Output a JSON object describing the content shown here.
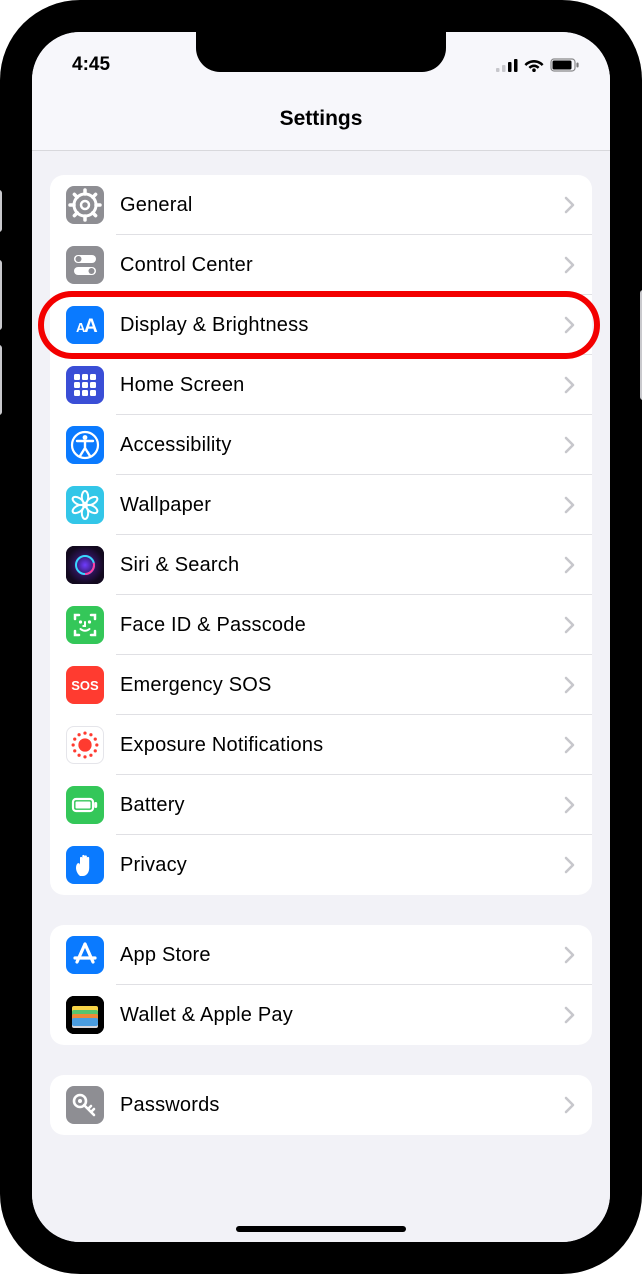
{
  "status": {
    "time": "4:45"
  },
  "header": {
    "title": "Settings"
  },
  "groups": [
    {
      "items": [
        {
          "id": "general",
          "label": "General",
          "icon": "gear",
          "iconBg": "#8e8e93",
          "highlighted": false
        },
        {
          "id": "control-center",
          "label": "Control Center",
          "icon": "toggles",
          "iconBg": "#8e8e93",
          "highlighted": false
        },
        {
          "id": "display-brightness",
          "label": "Display & Brightness",
          "icon": "textsize",
          "iconBg": "#0a7aff",
          "highlighted": true
        },
        {
          "id": "home-screen",
          "label": "Home Screen",
          "icon": "grid",
          "iconBg": "#3a4ed6",
          "highlighted": false
        },
        {
          "id": "accessibility",
          "label": "Accessibility",
          "icon": "accessibility",
          "iconBg": "#0a7aff",
          "highlighted": false
        },
        {
          "id": "wallpaper",
          "label": "Wallpaper",
          "icon": "flower",
          "iconBg": "#33c6e8",
          "highlighted": false
        },
        {
          "id": "siri-search",
          "label": "Siri & Search",
          "icon": "siri",
          "iconBg": "#1b1b2a",
          "highlighted": false
        },
        {
          "id": "faceid-passcode",
          "label": "Face ID & Passcode",
          "icon": "faceid",
          "iconBg": "#34c759",
          "highlighted": false
        },
        {
          "id": "emergency-sos",
          "label": "Emergency SOS",
          "icon": "sos",
          "iconBg": "#ff3b30",
          "highlighted": false
        },
        {
          "id": "exposure-notifs",
          "label": "Exposure Notifications",
          "icon": "exposure",
          "iconBg": "#ffffff",
          "highlighted": false
        },
        {
          "id": "battery",
          "label": "Battery",
          "icon": "battery",
          "iconBg": "#34c759",
          "highlighted": false
        },
        {
          "id": "privacy",
          "label": "Privacy",
          "icon": "hand",
          "iconBg": "#0a7aff",
          "highlighted": false
        }
      ]
    },
    {
      "items": [
        {
          "id": "app-store",
          "label": "App Store",
          "icon": "appstore",
          "iconBg": "#0a7aff",
          "highlighted": false
        },
        {
          "id": "wallet-applepay",
          "label": "Wallet & Apple Pay",
          "icon": "wallet",
          "iconBg": "#000000",
          "highlighted": false
        }
      ]
    },
    {
      "items": [
        {
          "id": "passwords",
          "label": "Passwords",
          "icon": "key",
          "iconBg": "#8e8e93",
          "highlighted": false
        }
      ]
    }
  ]
}
